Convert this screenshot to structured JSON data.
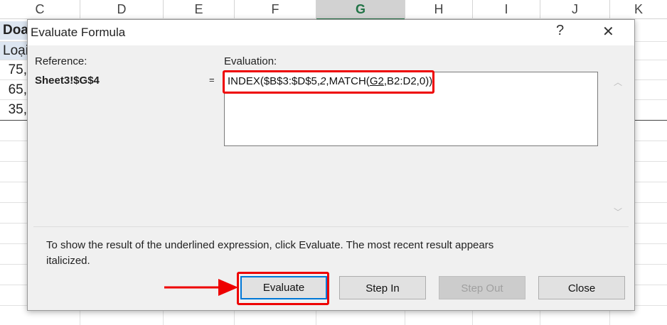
{
  "spreadsheet": {
    "columns": [
      "C",
      "D",
      "E",
      "F",
      "G",
      "H",
      "I",
      "J",
      "K"
    ],
    "selected_column": "G",
    "cells": [
      "Doa",
      "Loại",
      "75,",
      "65,",
      "35,"
    ]
  },
  "dialog": {
    "title": "Evaluate Formula",
    "help_label": "?",
    "close_label": "✕",
    "reference_label": "Reference:",
    "reference_value": "Sheet3!$G$4",
    "equals": "=",
    "evaluation_label": "Evaluation:",
    "formula": {
      "part1": "INDEX($B$3:$D$5,",
      "italic": "2",
      "part2": ",MATCH(",
      "underlined": "G2",
      "part3": ",B2:D2,0))"
    },
    "message": "To show the result of the underlined expression, click Evaluate.  The most recent result appears italicized.",
    "buttons": {
      "evaluate": "Evaluate",
      "step_in": "Step In",
      "step_out": "Step Out",
      "close": "Close"
    }
  },
  "colors": {
    "highlight": "#e00000",
    "selected_header": "#217346"
  }
}
